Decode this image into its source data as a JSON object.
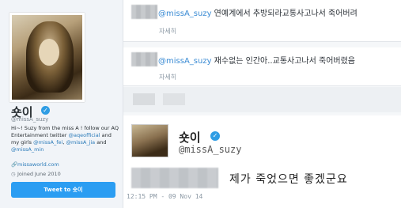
{
  "profile": {
    "display_name": "숏이",
    "handle": "@missA_suzy",
    "bio": {
      "part1": "Hi~! Suzy from the miss A ! follow our AQ Entertainment twitter ",
      "link1": "@aqeofficial",
      "part2": " and my girls ",
      "link2": "@missA_fei",
      "part3": ", ",
      "link3": "@missA_jia",
      "part4": " and ",
      "link4": "@missA_min"
    },
    "website": "missaworld.com",
    "joined": "Joined June 2010",
    "tweet_button": "Tweet to 숏이"
  },
  "tweets": [
    {
      "mention": "@missA_suzy",
      "text": " 연예계에서 추방되라교통사고나서 죽어버려",
      "detail": "자세히"
    },
    {
      "mention": "@missA_suzy",
      "text": " 재수없는 인간아..교통사고나서 죽어버렸음",
      "detail": "자세히"
    }
  ],
  "mobile_tweet": {
    "display_name": "숏이",
    "handle": "@missA_suzy",
    "text": "제가 죽었으면 좋겠군요",
    "time": "12:15 PM - 09 Nov 14"
  },
  "colors": {
    "accent": "#2b9df2",
    "link": "#2b7bb9",
    "verified": "#2f9de4"
  }
}
